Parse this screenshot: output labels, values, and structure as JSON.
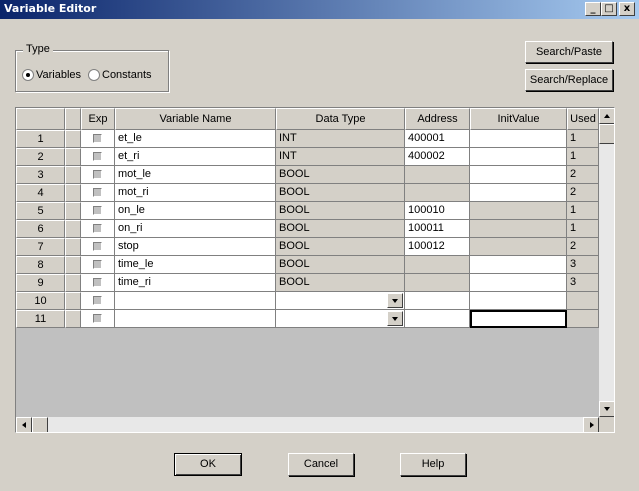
{
  "window": {
    "title": "Variable Editor",
    "controls": {
      "minimize": "_",
      "maximize": "□",
      "close": "x"
    }
  },
  "type_group": {
    "label": "Type",
    "options": [
      {
        "label": "Variables",
        "selected": true
      },
      {
        "label": "Constants",
        "selected": false
      }
    ]
  },
  "buttons": {
    "search_paste": "Search/Paste",
    "search_replace": "Search/Replace",
    "ok": "OK",
    "cancel": "Cancel",
    "help": "Help"
  },
  "table": {
    "headers": {
      "exp": "Exp",
      "name": "Variable Name",
      "type": "Data Type",
      "address": "Address",
      "init": "InitValue",
      "used": "Used"
    },
    "rows": [
      {
        "num": "1",
        "name": "et_le",
        "type": "INT",
        "address": "400001",
        "init": "",
        "used": "1"
      },
      {
        "num": "2",
        "name": "et_ri",
        "type": "INT",
        "address": "400002",
        "init": "",
        "used": "1"
      },
      {
        "num": "3",
        "name": "mot_le",
        "type": "BOOL",
        "address": "",
        "init": "",
        "used": "2"
      },
      {
        "num": "4",
        "name": "mot_ri",
        "type": "BOOL",
        "address": "",
        "init": "",
        "used": "2"
      },
      {
        "num": "5",
        "name": "on_le",
        "type": "BOOL",
        "address": "100010",
        "init": "",
        "used": "1"
      },
      {
        "num": "6",
        "name": "on_ri",
        "type": "BOOL",
        "address": "100011",
        "init": "",
        "used": "1"
      },
      {
        "num": "7",
        "name": "stop",
        "type": "BOOL",
        "address": "100012",
        "init": "",
        "used": "2"
      },
      {
        "num": "8",
        "name": "time_le",
        "type": "BOOL",
        "address": "",
        "init": "",
        "used": "3"
      },
      {
        "num": "9",
        "name": "time_ri",
        "type": "BOOL",
        "address": "",
        "init": "",
        "used": "3"
      },
      {
        "num": "10",
        "name": "",
        "type": "",
        "address": "",
        "init": "",
        "used": ""
      },
      {
        "num": "11",
        "name": "",
        "type": "",
        "address": "",
        "init": "",
        "used": ""
      }
    ]
  }
}
